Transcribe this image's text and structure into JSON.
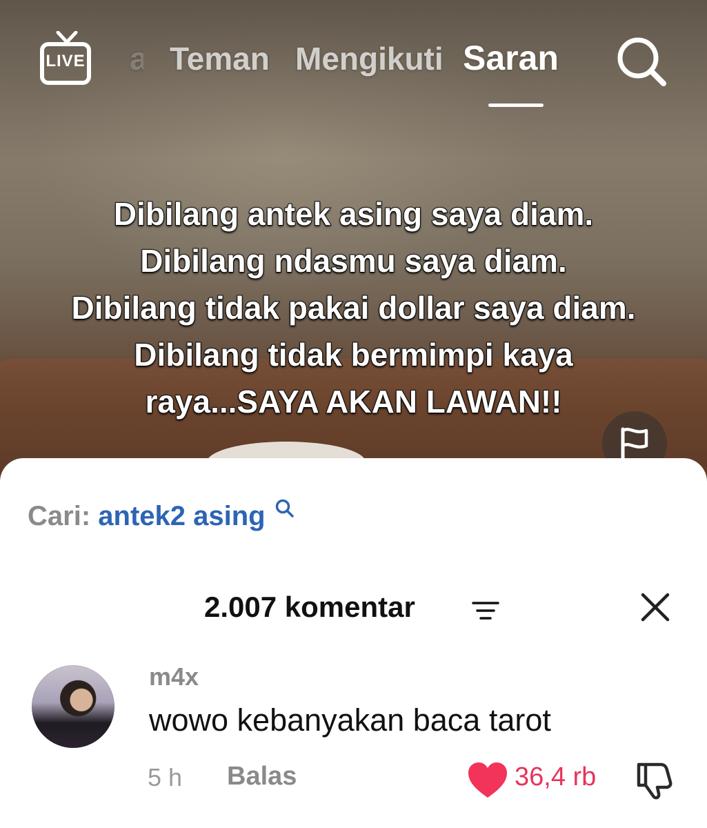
{
  "top_nav": {
    "live_label": "LIVE",
    "tabs": [
      {
        "label": "a"
      },
      {
        "label": "Teman"
      },
      {
        "label": "Mengikuti"
      },
      {
        "label": "Saran",
        "active": true
      }
    ],
    "search_icon": "search-icon"
  },
  "video": {
    "caption_lines": [
      "Dibilang antek asing saya diam.",
      "Dibilang ndasmu saya diam.",
      "Dibilang tidak pakai dollar saya diam.",
      "Dibilang tidak bermimpi kaya",
      "raya...SAYA AKAN LAWAN!!"
    ],
    "report_icon": "flag-icon"
  },
  "comments": {
    "search_label": "Cari:",
    "search_term": "antek2 asing",
    "count_label": "2.007 komentar",
    "sort_icon": "sort-icon",
    "close_icon": "close-icon",
    "items": [
      {
        "username": "m4x",
        "text": "wowo kebanyakan baca tarot",
        "time": "5 h",
        "reply_label": "Balas",
        "likes": "36,4 rb",
        "liked": true
      }
    ]
  },
  "colors": {
    "like": "#e8345a",
    "search_term": "#2d64b4",
    "muted_text": "#8a8a8a"
  }
}
